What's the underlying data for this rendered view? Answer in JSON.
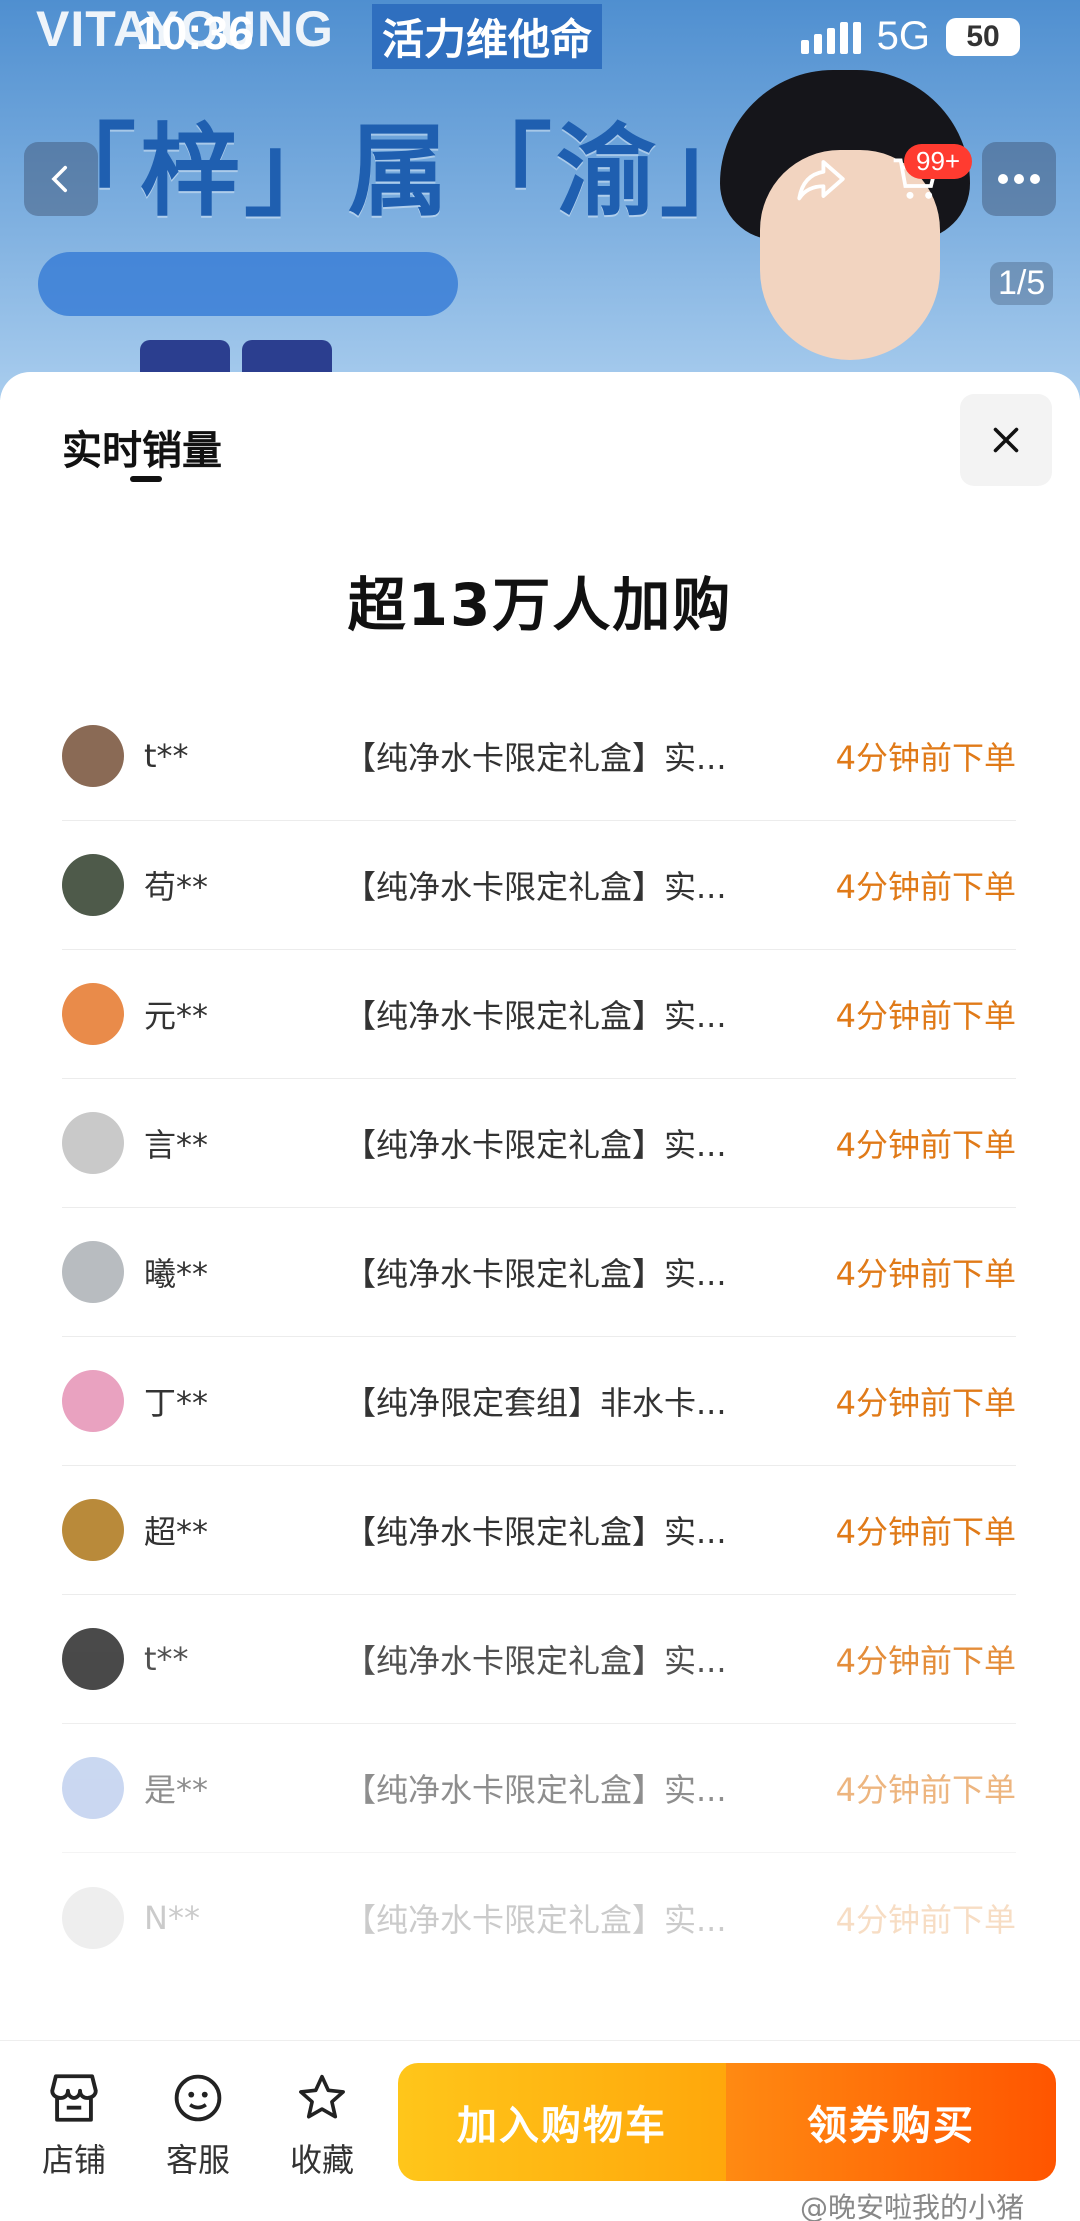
{
  "status": {
    "time": "10:36",
    "network": "5G",
    "battery": "50"
  },
  "banner": {
    "brand": "VITAYOUNG",
    "brand_cn": "活力维他命",
    "slogan": "「梓」属「渝」你",
    "page_indicator": "1/5",
    "cart_badge": "99+"
  },
  "sheet": {
    "tab_title": "实时销量",
    "headline": "超13万人加购"
  },
  "orders": [
    {
      "user": "t**",
      "product": "【纯净水卡限定礼盒】实...",
      "time": "4分钟前下单",
      "avatar_color": "#8a6a55"
    },
    {
      "user": "苟**",
      "product": "【纯净水卡限定礼盒】实...",
      "time": "4分钟前下单",
      "avatar_color": "#4e5a4a"
    },
    {
      "user": "元**",
      "product": "【纯净水卡限定礼盒】实...",
      "time": "4分钟前下单",
      "avatar_color": "#e98b4a"
    },
    {
      "user": "言**",
      "product": "【纯净水卡限定礼盒】实...",
      "time": "4分钟前下单",
      "avatar_color": "#c9c9c9"
    },
    {
      "user": "曦**",
      "product": "【纯净水卡限定礼盒】实...",
      "time": "4分钟前下单",
      "avatar_color": "#b8bcc0"
    },
    {
      "user": "丁**",
      "product": "【纯净限定套组】非水卡...",
      "time": "4分钟前下单",
      "avatar_color": "#e9a2c0"
    },
    {
      "user": "超**",
      "product": "【纯净水卡限定礼盒】实...",
      "time": "4分钟前下单",
      "avatar_color": "#b98a3a"
    },
    {
      "user": "t**",
      "product": "【纯净水卡限定礼盒】实...",
      "time": "4分钟前下单",
      "avatar_color": "#2a2a2a"
    },
    {
      "user": "是**",
      "product": "【纯净水卡限定礼盒】实...",
      "time": "4分钟前下单",
      "avatar_color": "#9fb8e6"
    },
    {
      "user": "N**",
      "product": "【纯净水卡限定礼盒】实...",
      "time": "4分钟前下单",
      "avatar_color": "#bcbcbc"
    }
  ],
  "bottom_bar": {
    "store": "店铺",
    "service": "客服",
    "favorite": "收藏",
    "add_to_cart": "加入购物车",
    "buy": "领券购买"
  },
  "watermark": "@晚安啦我的小猪",
  "colors": {
    "accent_orange": "#e07a18",
    "cart_yellow": "#ffb511",
    "buy_orange": "#ff6a08"
  }
}
